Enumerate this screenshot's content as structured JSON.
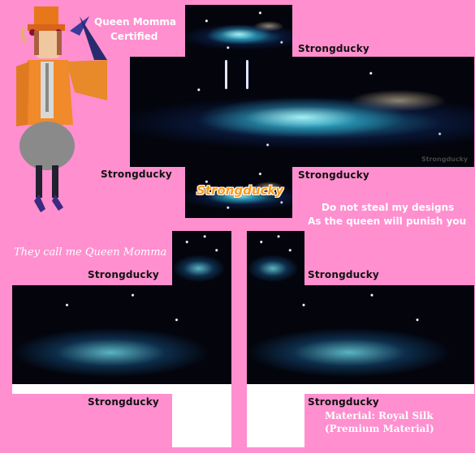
{
  "badge": {
    "line1": "Queen Momma",
    "line2": "Certified"
  },
  "tagline": "They call me Queen Momma",
  "watermark_labels": {
    "torso_top_right": "Strongducky",
    "torso_bottom_left": "Strongducky",
    "torso_bottom_right": "Strongducky",
    "torso_logo": "Strongducky",
    "torso_corner": "Strongducky",
    "left_sleeve_top": "Strongducky",
    "left_sleeve_bottom": "Strongducky",
    "right_sleeve_top": "Strongducky",
    "right_sleeve_bottom": "Strongducky"
  },
  "warning": {
    "line1": "Do not steal my designs",
    "line2": "As the queen will punish you"
  },
  "material": {
    "line1": "Material: Royal Silk",
    "line2": "(Premium Material)"
  },
  "colors": {
    "background": "#ff8fcf",
    "space": "#03040c",
    "nebula": "#4fd8ee",
    "logo": "#ff9a1a"
  },
  "icons": [
    "avatar-figure"
  ]
}
